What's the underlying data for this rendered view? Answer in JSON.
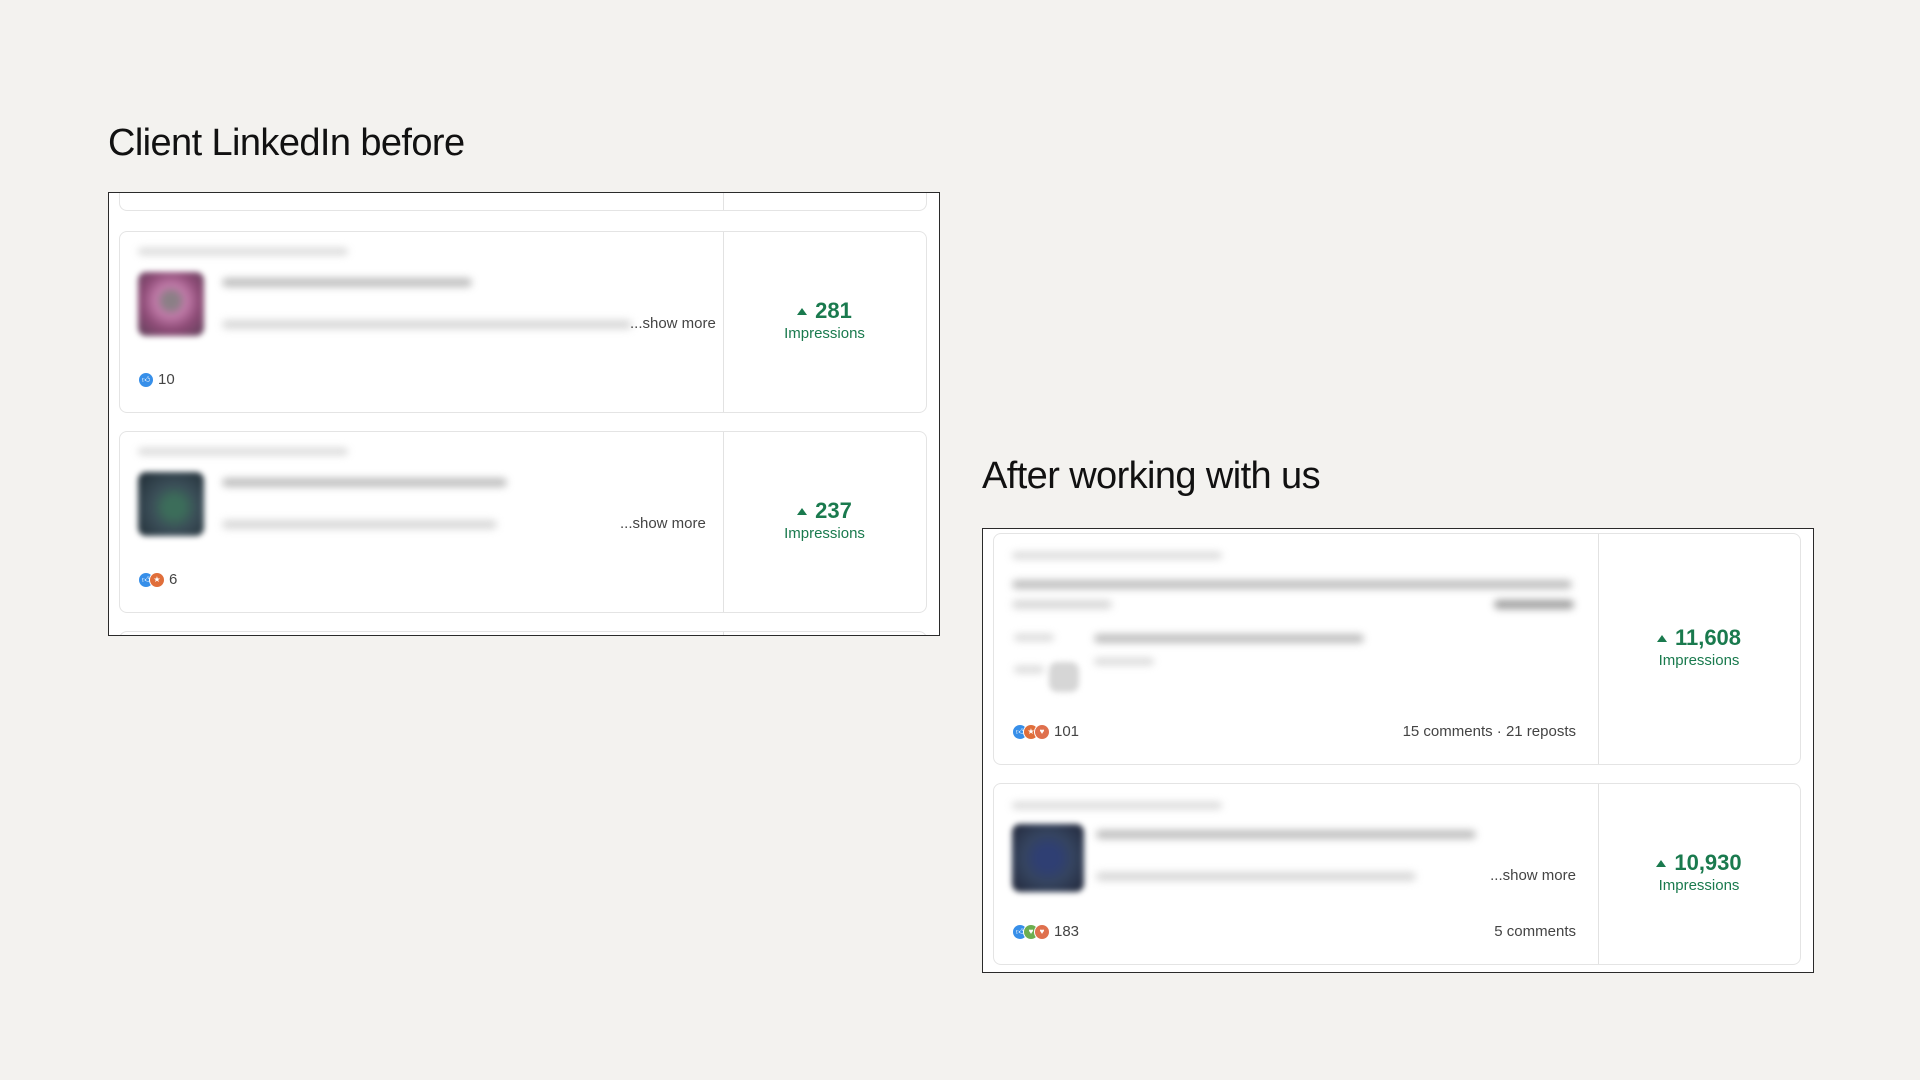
{
  "before": {
    "title": "Client LinkedIn before",
    "posts": [
      {
        "show_more": "...show more",
        "reactions_count": "10",
        "reactions": [
          "like-reaction-icon"
        ],
        "impressions_value": "281",
        "impressions_label": "Impressions"
      },
      {
        "show_more": "...show more",
        "reactions_count": "6",
        "reactions": [
          "like-reaction-icon",
          "celebrate-reaction-icon"
        ],
        "impressions_value": "237",
        "impressions_label": "Impressions"
      }
    ]
  },
  "after": {
    "title": "After working with us",
    "posts": [
      {
        "reactions_count": "101",
        "reactions": [
          "like-reaction-icon",
          "celebrate-reaction-icon",
          "love-reaction-icon"
        ],
        "engagement": "15 comments · 21 reposts",
        "impressions_value": "11,608",
        "impressions_label": "Impressions"
      },
      {
        "show_more": "...show more",
        "reactions_count": "183",
        "reactions": [
          "like-reaction-icon",
          "support-reaction-icon",
          "love-reaction-icon"
        ],
        "engagement": "5 comments",
        "impressions_value": "10,930",
        "impressions_label": "Impressions"
      }
    ]
  },
  "colors": {
    "background": "#f3f2ef",
    "impressions_green": "#1a7a4e",
    "frame_border": "#2a2a2a"
  }
}
